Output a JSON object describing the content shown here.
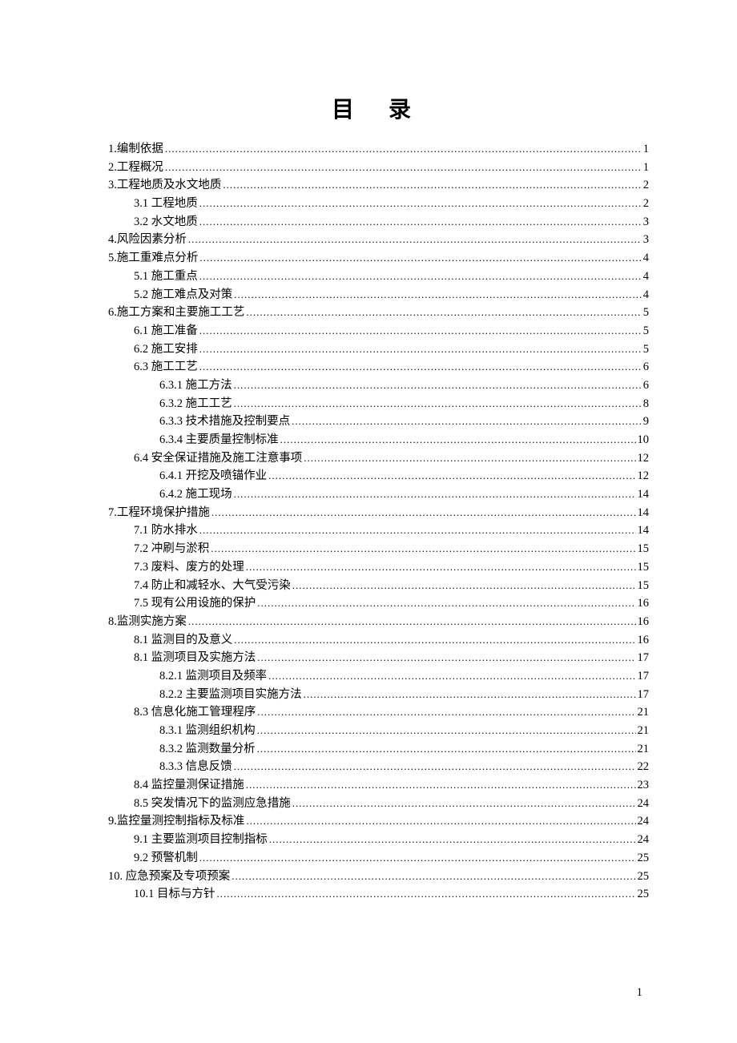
{
  "title": "目 录",
  "page_number": "1",
  "toc": [
    {
      "level": 1,
      "label": "1.编制依据",
      "page": "1"
    },
    {
      "level": 1,
      "label": "2.工程概况",
      "page": "1"
    },
    {
      "level": 1,
      "label": "3.工程地质及水文地质",
      "page": "2"
    },
    {
      "level": 2,
      "label": "3.1 工程地质",
      "page": "2"
    },
    {
      "level": 2,
      "label": "3.2 水文地质",
      "page": "3"
    },
    {
      "level": 1,
      "label": "4.风险因素分析",
      "page": "3"
    },
    {
      "level": 1,
      "label": "5.施工重难点分析",
      "page": "4"
    },
    {
      "level": 2,
      "label": "5.1 施工重点",
      "page": "4"
    },
    {
      "level": 2,
      "label": "5.2 施工难点及对策",
      "page": "4"
    },
    {
      "level": 1,
      "label": "6.施工方案和主要施工工艺",
      "page": "5"
    },
    {
      "level": 2,
      "label": "6.1 施工准备",
      "page": "5"
    },
    {
      "level": 2,
      "label": "6.2 施工安排",
      "page": "5"
    },
    {
      "level": 2,
      "label": "6.3 施工工艺",
      "page": "6"
    },
    {
      "level": 3,
      "label": "6.3.1 施工方法",
      "page": "6"
    },
    {
      "level": 3,
      "label": "6.3.2 施工工艺",
      "page": "8"
    },
    {
      "level": 3,
      "label": "6.3.3 技术措施及控制要点",
      "page": "9"
    },
    {
      "level": 3,
      "label": "6.3.4 主要质量控制标准",
      "page": "10"
    },
    {
      "level": 2,
      "label": "6.4 安全保证措施及施工注意事项",
      "page": "12"
    },
    {
      "level": 3,
      "label": "6.4.1 开挖及喷锚作业",
      "page": "12"
    },
    {
      "level": 3,
      "label": "6.4.2 施工现场",
      "page": "14"
    },
    {
      "level": 1,
      "label": "7.工程环境保护措施",
      "page": "14"
    },
    {
      "level": 2,
      "label": "7.1 防水排水",
      "page": "14"
    },
    {
      "level": 2,
      "label": "7.2 冲刷与淤积",
      "page": "15"
    },
    {
      "level": 2,
      "label": "7.3 废料、废方的处理",
      "page": "15"
    },
    {
      "level": 2,
      "label": "7.4 防止和减轻水、大气受污染",
      "page": "15"
    },
    {
      "level": 2,
      "label": "7.5 现有公用设施的保护",
      "page": "16"
    },
    {
      "level": 1,
      "label": "8.监测实施方案",
      "page": "16"
    },
    {
      "level": 2,
      "label": "8.1 监测目的及意义",
      "page": "16"
    },
    {
      "level": 2,
      "label": "8.1 监测项目及实施方法",
      "page": "17"
    },
    {
      "level": 3,
      "label": "8.2.1 监测项目及频率",
      "page": "17"
    },
    {
      "level": 3,
      "label": "8.2.2 主要监测项目实施方法",
      "page": "17"
    },
    {
      "level": 2,
      "label": "8.3 信息化施工管理程序",
      "page": "21"
    },
    {
      "level": 3,
      "label": "8.3.1 监测组织机构",
      "page": "21"
    },
    {
      "level": 3,
      "label": "8.3.2 监测数量分析",
      "page": "21"
    },
    {
      "level": 3,
      "label": "8.3.3 信息反馈",
      "page": "22"
    },
    {
      "level": 2,
      "label": "8.4 监控量测保证措施",
      "page": "23"
    },
    {
      "level": 2,
      "label": "8.5 突发情况下的监测应急措施",
      "page": "24"
    },
    {
      "level": 1,
      "label": "9.监控量测控制指标及标准",
      "page": "24"
    },
    {
      "level": 2,
      "label": "9.1 主要监测项目控制指标",
      "page": "24"
    },
    {
      "level": 2,
      "label": "9.2 预警机制",
      "page": "25"
    },
    {
      "level": 1,
      "label": "10. 应急预案及专项预案",
      "page": "25"
    },
    {
      "level": 2,
      "label": "10.1 目标与方针",
      "page": "25"
    }
  ]
}
